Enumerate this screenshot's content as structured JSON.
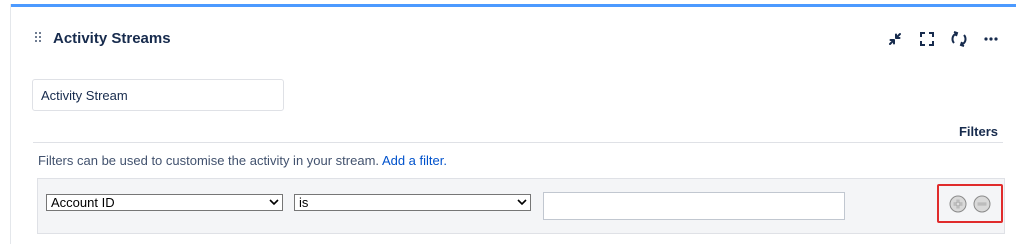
{
  "gadget": {
    "title": "Activity Streams",
    "header_icons": [
      "collapse-icon",
      "fullscreen-icon",
      "refresh-icon",
      "more-icon"
    ],
    "more_glyph": "···"
  },
  "form": {
    "title_value": "Activity Stream"
  },
  "filters": {
    "heading": "Filters",
    "description": "Filters can be used to customise the activity in your stream.",
    "add_link": "Add a filter.",
    "rows": [
      {
        "field": "Account ID",
        "operator": "is",
        "value": ""
      }
    ]
  },
  "colors": {
    "accent_bar": "#4c9aff",
    "link": "#0052cc",
    "highlight_box": "#e02b2b"
  }
}
